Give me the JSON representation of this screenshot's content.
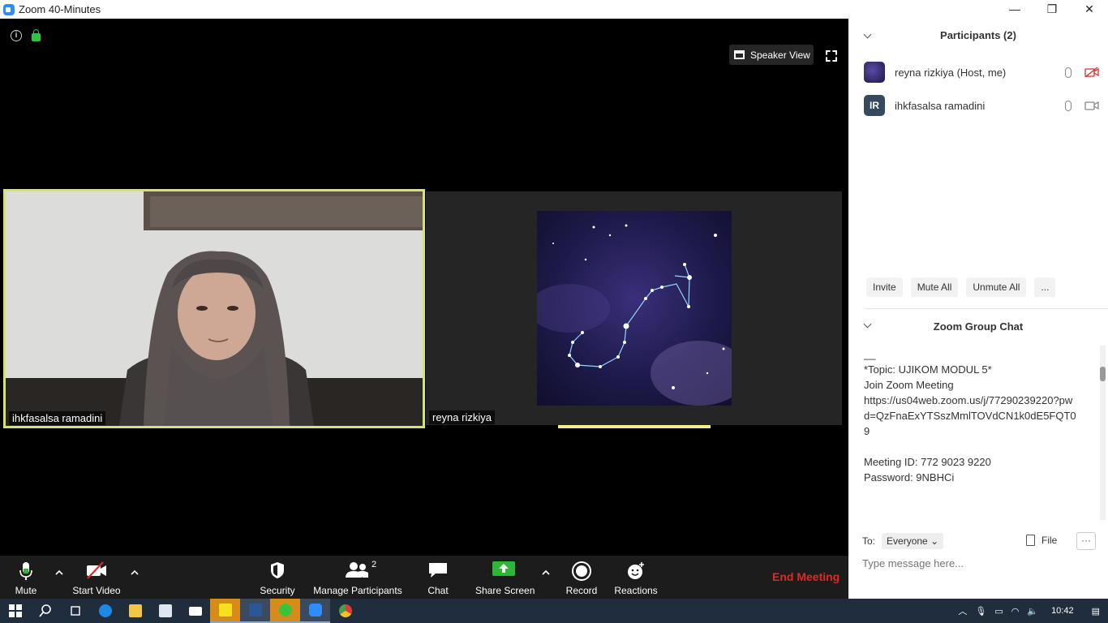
{
  "window": {
    "title": "Zoom 40-Minutes",
    "minimize": "—",
    "restore": "❐",
    "close": "✕"
  },
  "top_controls": {
    "speaker_view_label": "Speaker View"
  },
  "video_tiles": [
    {
      "name": "ihkfasalsa ramadini"
    },
    {
      "name": "reyna rizkiya"
    }
  ],
  "toolbar": {
    "mute": "Mute",
    "start_video": "Start Video",
    "security": "Security",
    "manage_participants": "Manage Participants",
    "participant_count": "2",
    "chat": "Chat",
    "share_screen": "Share Screen",
    "record": "Record",
    "reactions": "Reactions",
    "end_meeting": "End Meeting",
    "colors": {
      "end": "#e02828",
      "share": "#2fb537",
      "speaking_border": "#d6e36f"
    }
  },
  "participants_panel": {
    "title": "Participants (2)",
    "participants": [
      {
        "name": "reyna rizkiya (Host, me)",
        "initials": "",
        "video_on": false
      },
      {
        "name": "ihkfasalsa ramadini",
        "initials": "IR",
        "video_on": true
      }
    ],
    "invite": "Invite",
    "mute_all": "Mute All",
    "unmute_all": "Unmute All",
    "more": "..."
  },
  "chat_panel": {
    "title": "Zoom Group Chat",
    "rule": "—————————————————",
    "lines": [
      "__",
      "*Topic: UJIKOM MODUL 5*",
      "Join Zoom Meeting",
      "https://us04web.zoom.us/j/77290239220?pwd=QzFnaExYTSszMmlTOVdCN1k0dE5FQT09",
      "",
      "Meeting ID: 772 9023 9220",
      "Password: 9NBHCi"
    ],
    "to_label": "To:",
    "recipient": "Everyone",
    "file": "File",
    "more": "···",
    "placeholder": "Type message here..."
  },
  "taskbar": {
    "time": "10:42"
  }
}
